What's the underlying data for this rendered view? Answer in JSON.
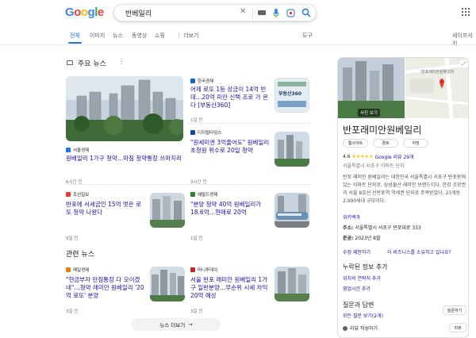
{
  "header": {
    "logo": [
      {
        "ch": "G",
        "color": "#4285F4"
      },
      {
        "ch": "o",
        "color": "#EA4335"
      },
      {
        "ch": "o",
        "color": "#FBBC05"
      },
      {
        "ch": "g",
        "color": "#4285F4"
      },
      {
        "ch": "l",
        "color": "#34A853"
      },
      {
        "ch": "e",
        "color": "#EA4335"
      }
    ],
    "query": "반베일리"
  },
  "tabs": [
    {
      "label": "전체",
      "active": true
    },
    {
      "label": "이미지"
    },
    {
      "label": "뉴스"
    },
    {
      "label": "동영상"
    },
    {
      "label": "쇼핑"
    },
    {
      "label": "⋮ 더보기"
    },
    {
      "label": "도구"
    }
  ],
  "safe_search_label": "세이프서치",
  "top_news": {
    "title": "주요 뉴스",
    "featured": {
      "source": "서울경제",
      "title": "원베일리 1가구 청약…마침 청약통장 쓰마지리",
      "time": "6시간 전"
    },
    "items": [
      {
        "source": "한국경제",
        "title": "어제 로또 1등 상금이 14억 빈데…20억 미만 신택 조로 가 온다 [부동산360]",
        "time": "1일 전",
        "thumb_label": "부동산360"
      },
      {
        "source": "디지털타임스",
        "title": "\"원세미엔 3억줄어도\" 원베일리 초청원 위수로 20일 청약",
        "time": "9시간 전"
      },
      {
        "source": "조선일보",
        "title": "반포에 서세금인 15억 벗은 로또 청약 나왔다",
        "time": "9일 전"
      },
      {
        "source": "헤럴드경제",
        "title": "\"분양 청약 40억 원베일리가 18.6억…현매로 20억",
        "time": "1일 전"
      }
    ]
  },
  "related_news": {
    "title": "관련 뉴스",
    "items": [
      {
        "source": "매일경제",
        "title": "\"현금부자 만점통장 다 모이겠네\"…청약 래미안 원베일리 '20억 로또' 분양",
        "time": "3일 전"
      },
      {
        "source": "머니투데이",
        "title": "서울 반포 래미안 원베일리 1가구 일반분양…무순위 시세 차익 20억 예상",
        "time": "3일 전"
      }
    ],
    "more": "뉴스 더보기"
  },
  "knowledge_panel": {
    "photo_label": "사진 보기",
    "map_label": "반포래미안원베일리",
    "title": "반포래미안원베일리",
    "chips": [
      "웹사이트",
      "경로",
      "저장"
    ],
    "rating": "4.6",
    "stars": "★★★★★",
    "reviews": "Google 리뷰 29개",
    "category": "서울특별시 서초구 아파트 단지",
    "description": "반포 래미안 원베일리는 대한민국 서울특별시 서초구 반포동에 있는 아파트 단지로, 삼성물산 래미안 브랜드이다. 한강 조망권과 서울 8호선 신반포역 역세권 단지로 주목받았다. 23개동 2,990세대 규모이다.",
    "more_link": "위키백과",
    "address_label": "주소:",
    "address": "서울특별시 서초구 반포대로 333",
    "completion_label": "준공:",
    "completion": "2023년 8월",
    "links": [
      "수정 제안하기",
      "이 비즈니스를 소유하고 있나요?"
    ],
    "missing_title": "누락된 정보 추가",
    "missing": [
      "위치의 연락처 추가",
      "영업시간 추가"
    ],
    "qa_title": "질문과 답변",
    "qa_link": "모든 질문 보기(2개)",
    "qa_btn": "질문하기",
    "review_link": "리뷰 작성하기",
    "review_btn": "리뷰"
  },
  "colors": {
    "link": "#1a0dab",
    "accent": "#1a73e8",
    "meta": "#70757a"
  }
}
